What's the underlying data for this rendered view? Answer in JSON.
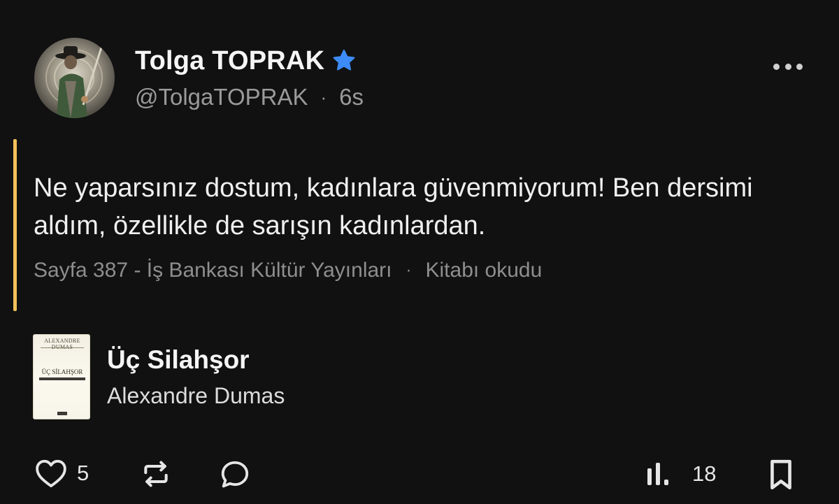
{
  "author": {
    "display_name": "Tolga TOPRAK",
    "handle": "@TolgaTOPRAK",
    "time_ago": "6s",
    "separator": "·",
    "verified": true
  },
  "quote": {
    "text": "Ne yaparsınız dostum, kadınlara güvenmiyorum! Ben dersimi aldım, özellikle de sarışın kadınlardan.",
    "page_info": "Sayfa 387 - İş Bankası Kültür Yayınları",
    "separator": "·",
    "status": "Kitabı okudu",
    "accent_color": "#f3c15a"
  },
  "book": {
    "title": "Üç Silahşor",
    "author": "Alexandre Dumas",
    "cover_author_text": "ALEXANDRE DUMAS",
    "cover_title_text": "ÜÇ SİLAHŞOR"
  },
  "actions": {
    "likes": "5",
    "views": "18"
  },
  "icons": {
    "more": "more-horizontal-icon",
    "like": "heart-icon",
    "repost": "repost-icon",
    "reply": "speech-bubble-icon",
    "views": "bar-chart-icon",
    "bookmark": "bookmark-icon",
    "verified": "verified-star-icon"
  },
  "colors": {
    "background": "#111111",
    "verified": "#3d8bf5",
    "muted_text": "#9a9a9a"
  }
}
